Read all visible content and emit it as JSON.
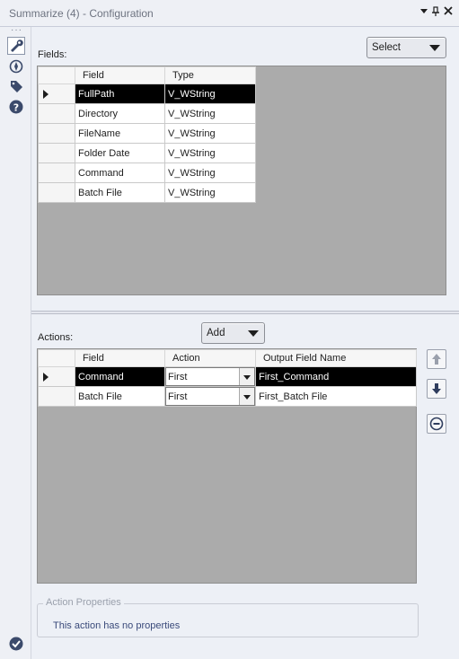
{
  "window": {
    "title": "Summarize (4) - Configuration",
    "menu_icon": "dropdown-triangle-icon",
    "pin_icon": "pin-icon",
    "close_icon": "close-icon"
  },
  "toolbar": {
    "icons": [
      "wrench-icon",
      "compass-icon",
      "tag-icon",
      "help-icon"
    ],
    "bottom_icon": "check-circle-icon"
  },
  "fields_section": {
    "label": "Fields:",
    "select_label": "Select",
    "columns": [
      "Field",
      "Type"
    ],
    "rows": [
      {
        "field": "FullPath",
        "type": "V_WString",
        "selected": true
      },
      {
        "field": "Directory",
        "type": "V_WString"
      },
      {
        "field": "FileName",
        "type": "V_WString"
      },
      {
        "field": "Folder Date",
        "type": "V_WString"
      },
      {
        "field": "Command",
        "type": "V_WString"
      },
      {
        "field": "Batch File",
        "type": "V_WString"
      }
    ]
  },
  "actions_section": {
    "label": "Actions:",
    "add_label": "Add",
    "columns": [
      "Field",
      "Action",
      "Output Field Name"
    ],
    "rows": [
      {
        "field": "Command",
        "action": "First",
        "output": "First_Command",
        "selected": true
      },
      {
        "field": "Batch File",
        "action": "First",
        "output": "First_Batch File"
      }
    ],
    "side_buttons": [
      "move-up-icon",
      "move-down-icon",
      "remove-icon"
    ]
  },
  "action_properties": {
    "title": "Action Properties",
    "text": "This action has no properties"
  },
  "colors": {
    "panel_bg": "#edf0f6",
    "grid_bg": "#ababab",
    "selected_row": "#000000",
    "row_cursor": "#a9d3f4"
  }
}
